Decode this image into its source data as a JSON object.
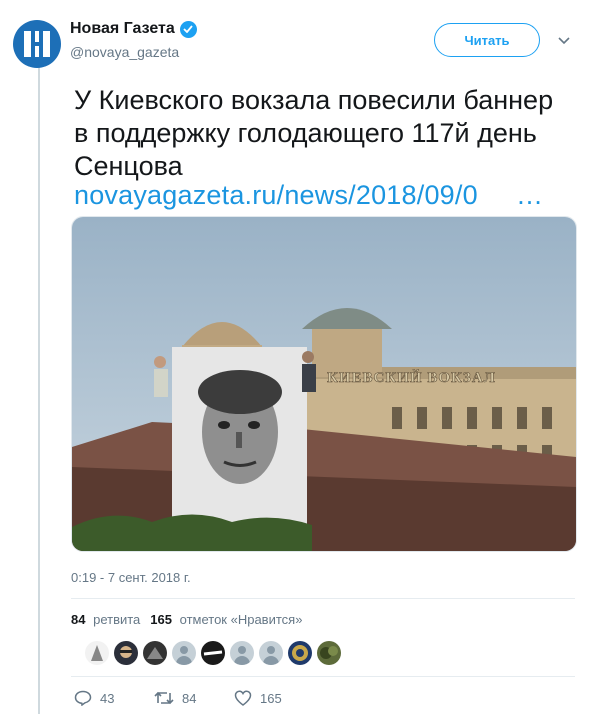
{
  "author": {
    "name": "Новая Газета",
    "handle": "@novaya_gazeta",
    "verified": true
  },
  "follow_label": "Читать",
  "tweet": {
    "text": "У Киевского вокзала повесили баннер в поддержку голодающего 117й день Сенцова",
    "link": "novayagazeta.ru/news/2018/09/0",
    "link_ellipsis": "…"
  },
  "media": {
    "building_sign": "КИЕВСКИЙ ВОКЗАЛ"
  },
  "timestamp": "0:19 - 7 сент. 2018 г.",
  "stats": {
    "retweets_count": "84",
    "retweets_label": "ретвита",
    "likes_count": "165",
    "likes_label": "отметок «Нравится»"
  },
  "actions": {
    "reply_count": "43",
    "retweet_count": "84",
    "like_count": "165"
  },
  "colors": {
    "accent": "#1da1f2",
    "link": "#1b95e0",
    "brand": "#1d6fb7"
  }
}
